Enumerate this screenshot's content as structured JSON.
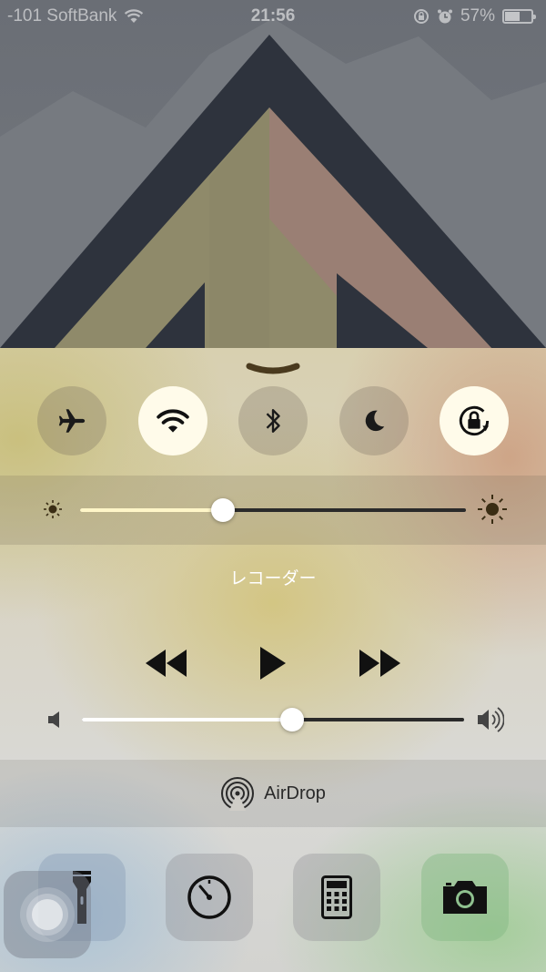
{
  "status_bar": {
    "carrier": "-101 SoftBank",
    "time": "21:56",
    "battery_percent": "57%",
    "battery_level": 0.57
  },
  "toggles": [
    {
      "name": "airplane-mode",
      "icon": "airplane-icon",
      "state": "off"
    },
    {
      "name": "wifi",
      "icon": "wifi-icon",
      "state": "on"
    },
    {
      "name": "bluetooth",
      "icon": "bluetooth-icon",
      "state": "off"
    },
    {
      "name": "do-not-disturb",
      "icon": "moon-icon",
      "state": "off"
    },
    {
      "name": "rotation-lock",
      "icon": "rotation-lock-icon",
      "state": "on"
    }
  ],
  "brightness": {
    "level": 0.37
  },
  "now_playing": {
    "title": "レコーダー"
  },
  "volume": {
    "level": 0.55
  },
  "airdrop": {
    "label": "AirDrop"
  },
  "shortcuts": [
    {
      "name": "flashlight",
      "icon": "flashlight-icon"
    },
    {
      "name": "timer",
      "icon": "timer-icon"
    },
    {
      "name": "calculator",
      "icon": "calculator-icon"
    },
    {
      "name": "camera",
      "icon": "camera-icon"
    }
  ],
  "colors": {
    "toggle_on": "#fffbea",
    "brightness_fill": "#fff6c8",
    "volume_fill": "#ffffff"
  }
}
